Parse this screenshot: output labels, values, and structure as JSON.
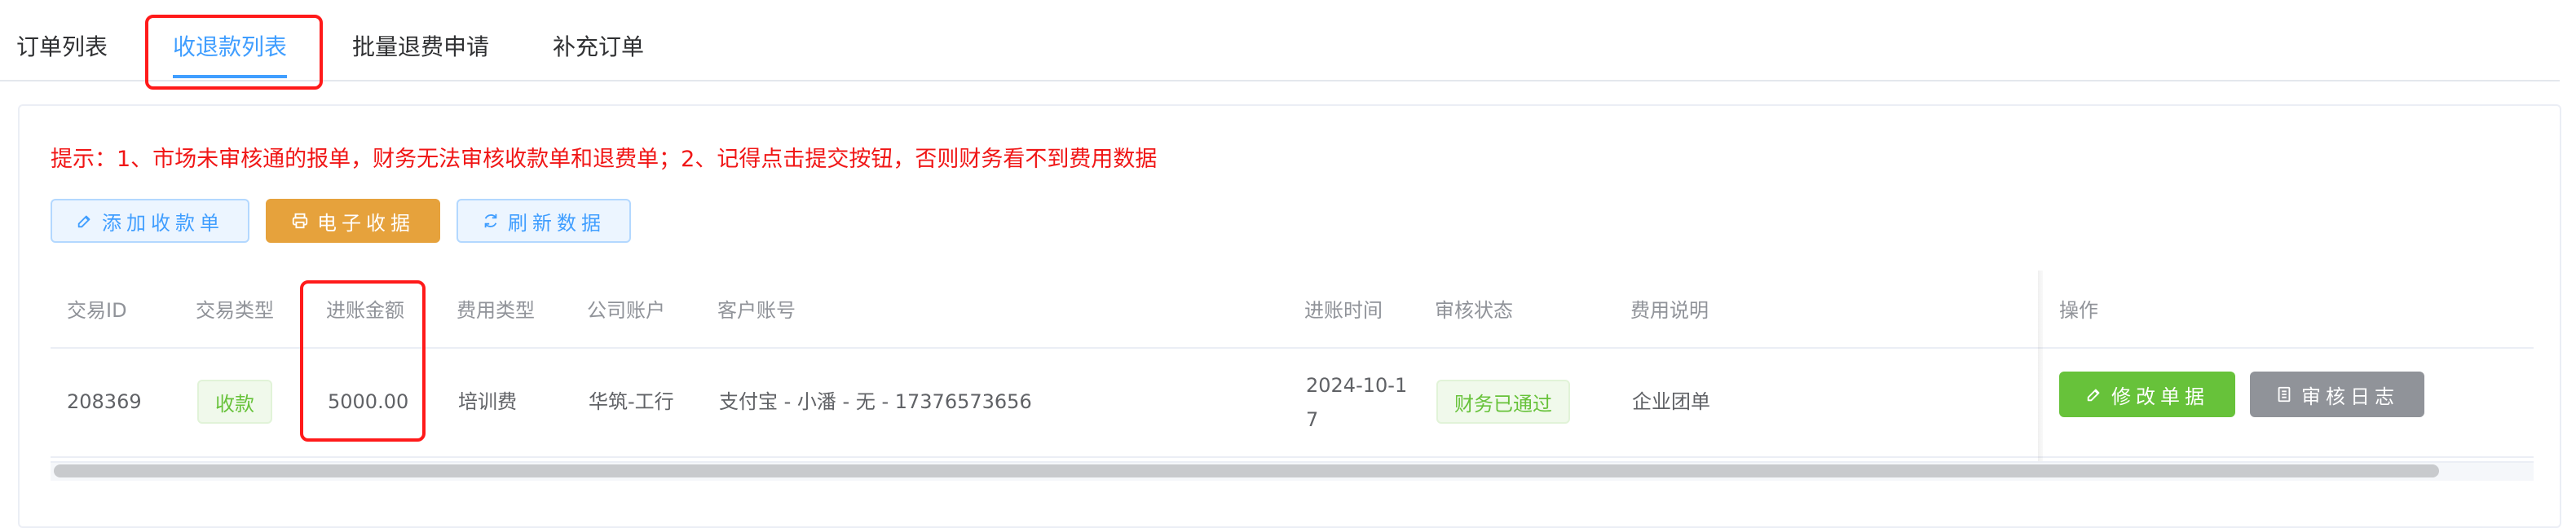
{
  "tabs": [
    {
      "label": "订单列表"
    },
    {
      "label": "收退款列表",
      "active": true
    },
    {
      "label": "批量退费申请"
    },
    {
      "label": "补充订单"
    }
  ],
  "tip": "提示：1、市场未审核通的报单，财务无法审核收款单和退费单；2、记得点击提交按钮，否则财务看不到费用数据",
  "toolbar": {
    "add_receipt": "添加收款单",
    "e_receipt": "电子收据",
    "refresh": "刷新数据"
  },
  "table": {
    "columns": [
      "交易ID",
      "交易类型",
      "进账金额",
      "费用类型",
      "公司账户",
      "客户账号",
      "进账时间",
      "审核状态",
      "费用说明",
      "操作"
    ],
    "rows": [
      {
        "id": "208369",
        "type": "收款",
        "amount": "5000.00",
        "fee_type": "培训费",
        "company_account": "华筑-工行",
        "customer_account": "支付宝 - 小潘 - 无 - 17376573656",
        "time_line1": "2024-10-1",
        "time_line2": "7",
        "status": "财务已通过",
        "remark": "企业团单",
        "actions": {
          "edit": "修改单据",
          "log": "审核日志"
        }
      }
    ]
  },
  "colors": {
    "accent": "#409eff",
    "warning_text": "#f01616",
    "orange": "#e6a23c",
    "success": "#67c23a",
    "info": "#909399",
    "highlight": "#ff1a1a"
  },
  "icons": {
    "add_receipt": "edit-icon",
    "e_receipt": "printer-icon",
    "refresh": "refresh-icon",
    "edit": "edit-icon",
    "log": "document-icon"
  }
}
